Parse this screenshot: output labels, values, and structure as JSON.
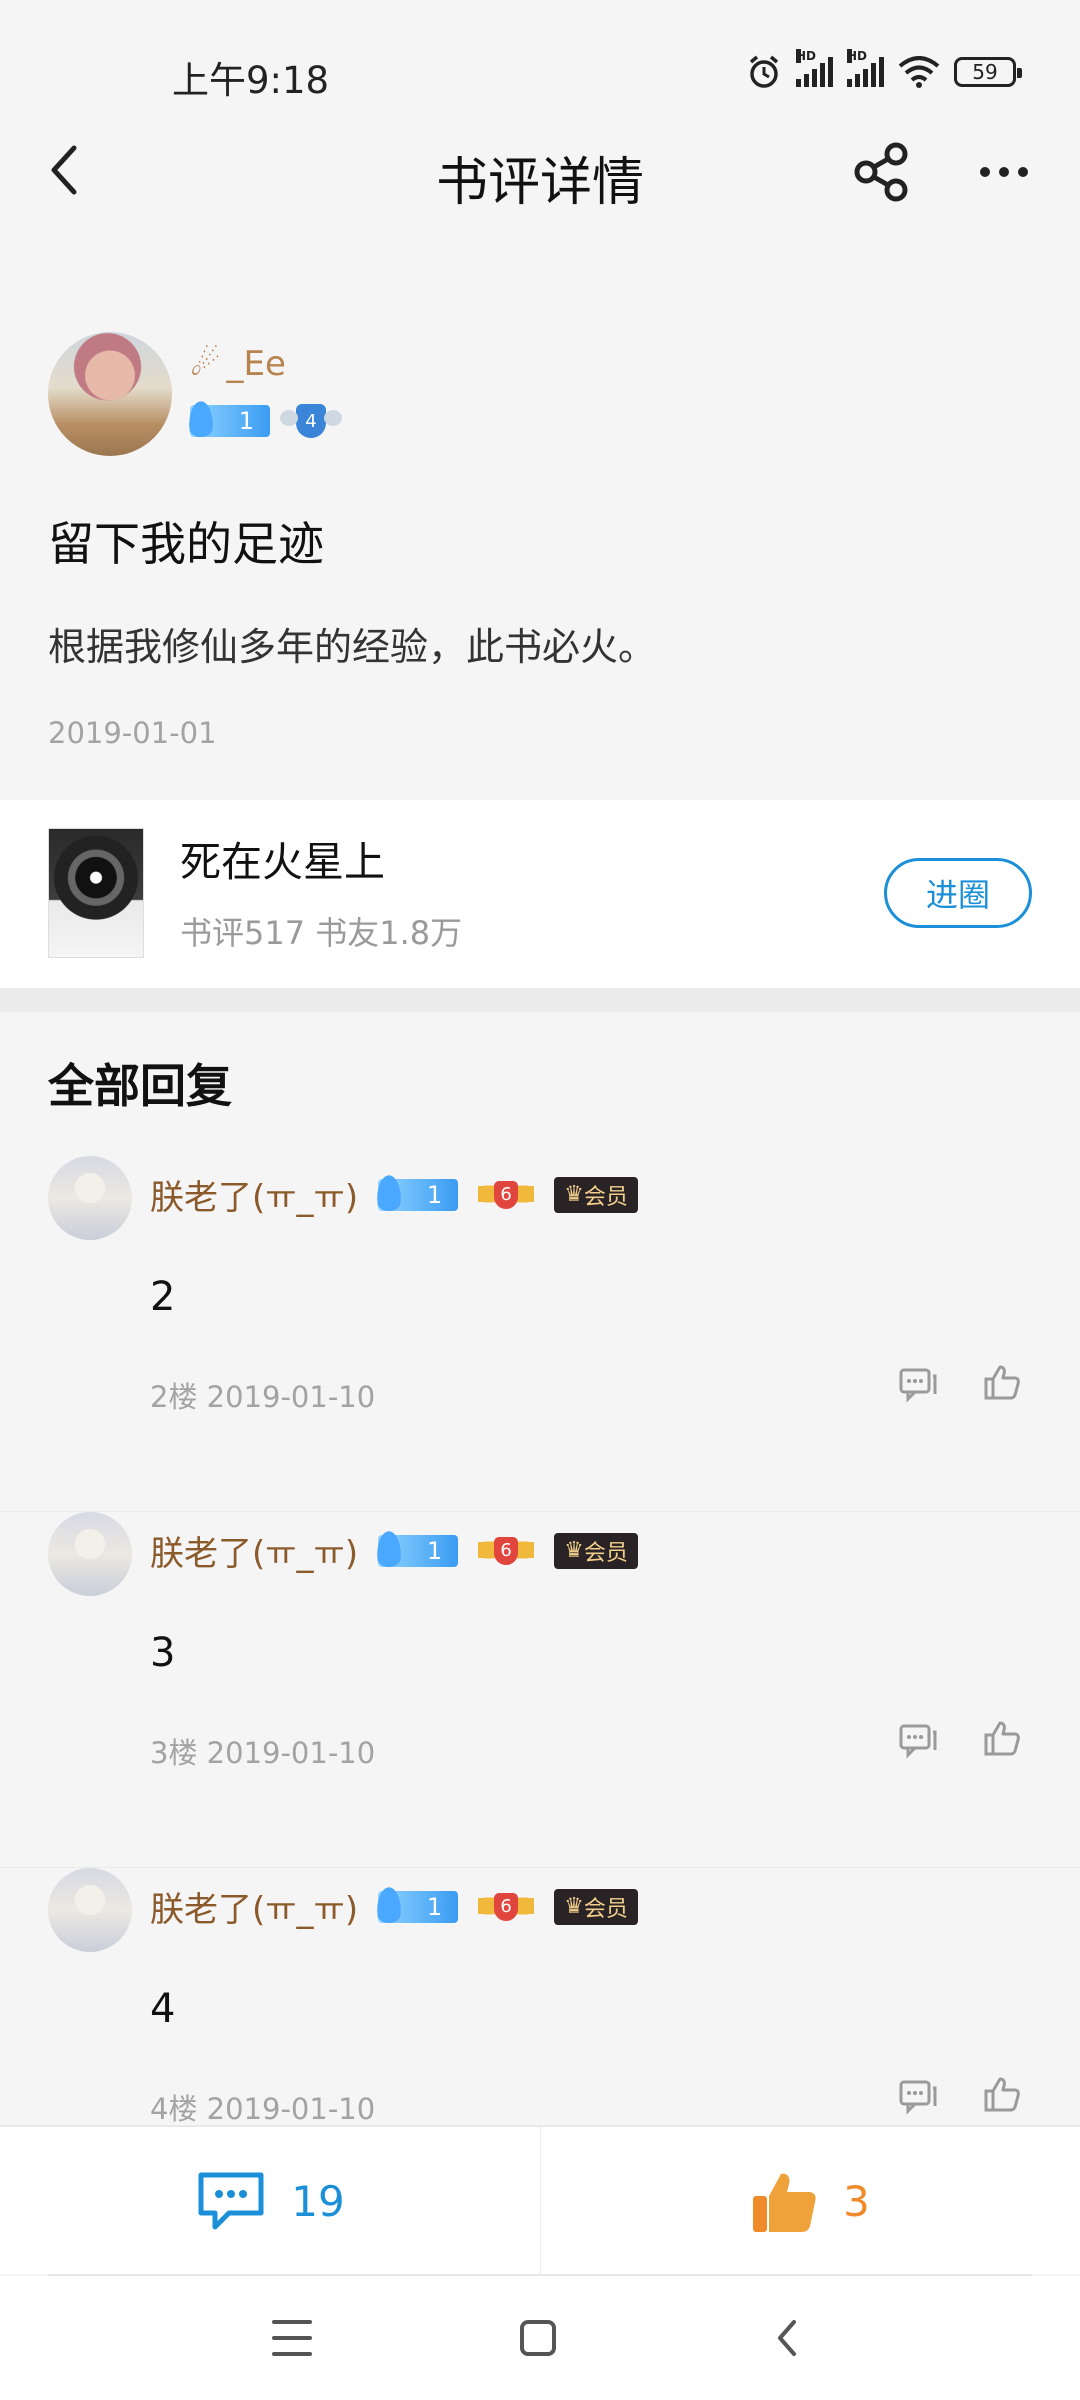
{
  "status_bar": {
    "time": "上午9:18",
    "battery": "59",
    "hd_labels": [
      "HD",
      "HD"
    ]
  },
  "header": {
    "title": "书评详情",
    "back_icon": "chevron-left-icon",
    "share_icon": "share-icon",
    "more_icon": "more-dots-icon"
  },
  "review": {
    "author": {
      "name_prefix": "☄",
      "name": "_Ee",
      "fire_level": "1",
      "shield_level": "4"
    },
    "title": "留下我的足迹",
    "body": "根据我修仙多年的经验，此书必火。",
    "date": "2019-01-01"
  },
  "book": {
    "title": "死在火星上",
    "meta": "书评517 书友1.8万",
    "join_label": "进圈"
  },
  "replies_heading": "全部回复",
  "replies": [
    {
      "name": "朕老了(ㅠ_ㅠ)",
      "fire_level": "1",
      "lv": "6",
      "vip": "会员",
      "text": "2",
      "meta": "2楼 2019-01-10"
    },
    {
      "name": "朕老了(ㅠ_ㅠ)",
      "fire_level": "1",
      "lv": "6",
      "vip": "会员",
      "text": "3",
      "meta": "3楼 2019-01-10"
    },
    {
      "name": "朕老了(ㅠ_ㅠ)",
      "fire_level": "1",
      "lv": "6",
      "vip": "会员",
      "text": "4",
      "meta": "4楼 2019-01-10"
    }
  ],
  "bottom_bar": {
    "comment_count": "19",
    "like_count": "3"
  },
  "colors": {
    "accent_blue": "#1c8fd9",
    "like_orange": "#f08b2c",
    "author_gold": "#b7834f",
    "reply_name_brown": "#8b5a2b"
  }
}
